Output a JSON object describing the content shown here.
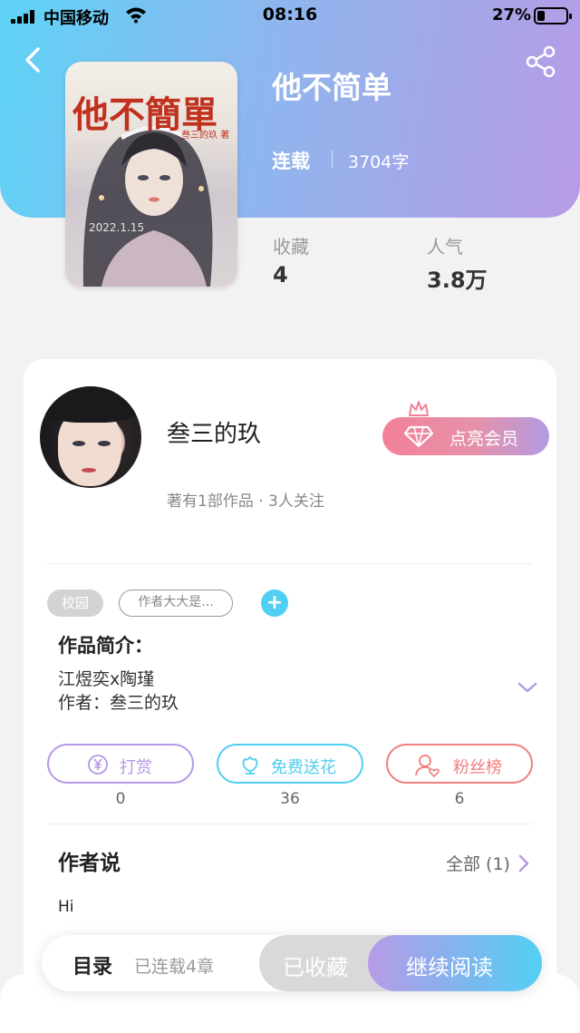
{
  "status_bar": {
    "carrier": "中国移动",
    "time": "08:16",
    "battery": "27%"
  },
  "book": {
    "title": "他不简单",
    "status": "连载",
    "word_count": "3704字",
    "cover": {
      "title": "他不簡單",
      "author": "叁三的玖 著",
      "date": "2022.1.15"
    },
    "stats": [
      {
        "label": "收藏",
        "value": "4"
      },
      {
        "label": "人气",
        "value": "3.8万"
      }
    ]
  },
  "author": {
    "name": "叁三的玖",
    "meta": "著有1部作品 · 3人关注",
    "vip_label": "点亮会员"
  },
  "tags": [
    "校园",
    "作者大大是..."
  ],
  "intro": {
    "title": "作品简介：",
    "lines": [
      "江煜奕x陶瑾",
      "作者：叁三的玖"
    ]
  },
  "actions": [
    {
      "label": "打赏",
      "count": "0",
      "color": "#b598e4",
      "icon": "yen-icon"
    },
    {
      "label": "免费送花",
      "count": "36",
      "color": "#4fcdf0",
      "icon": "flower-icon"
    },
    {
      "label": "粉丝榜",
      "count": "6",
      "color": "#ef7e7e",
      "icon": "fan-icon"
    }
  ],
  "author_says": {
    "title": "作者说",
    "all_label": "全部 (1)",
    "text": "Hi"
  },
  "bottom_bar": {
    "toc_label": "目录",
    "chapter_count": "已连载4章",
    "fav_label": "已收藏",
    "read_label": "继续阅读"
  }
}
